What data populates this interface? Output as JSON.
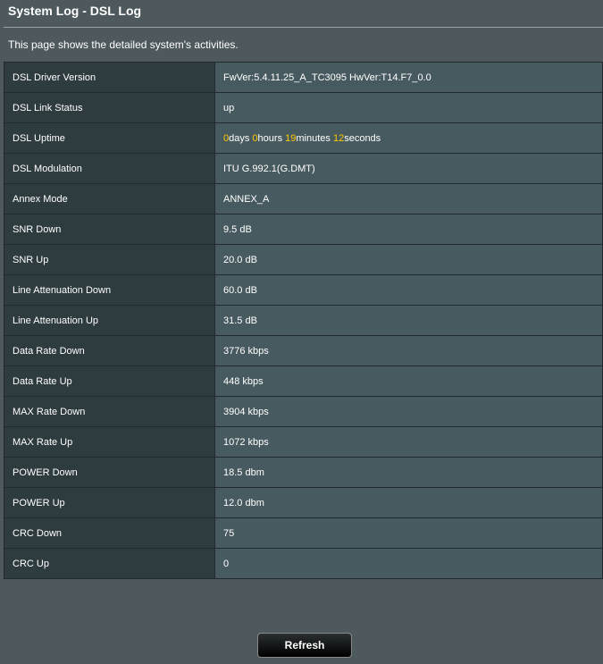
{
  "header": {
    "title": "System Log - DSL Log",
    "description": "This page shows the detailed system's activities."
  },
  "rows": [
    {
      "label": "DSL Driver Version",
      "value": "FwVer:5.4.11.25_A_TC3095 HwVer:T14.F7_0.0"
    },
    {
      "label": "DSL Link Status",
      "value": "up"
    },
    {
      "label": "DSL Uptime",
      "uptime": {
        "days": "0",
        "days_unit": "days ",
        "hours": "0",
        "hours_unit": "hours ",
        "minutes": "19",
        "minutes_unit": "minutes ",
        "seconds": "12",
        "seconds_unit": "seconds"
      }
    },
    {
      "label": "DSL Modulation",
      "value": "ITU G.992.1(G.DMT)"
    },
    {
      "label": "Annex Mode",
      "value": "ANNEX_A"
    },
    {
      "label": "SNR Down",
      "value": "9.5 dB"
    },
    {
      "label": "SNR Up",
      "value": "20.0 dB"
    },
    {
      "label": "Line Attenuation Down",
      "value": "60.0 dB"
    },
    {
      "label": "Line Attenuation Up",
      "value": "31.5 dB"
    },
    {
      "label": "Data Rate Down",
      "value": "3776 kbps"
    },
    {
      "label": "Data Rate Up",
      "value": "448 kbps"
    },
    {
      "label": "MAX Rate Down",
      "value": "3904 kbps"
    },
    {
      "label": "MAX Rate Up",
      "value": "1072 kbps"
    },
    {
      "label": "POWER Down",
      "value": "18.5 dbm"
    },
    {
      "label": "POWER Up",
      "value": "12.0 dbm"
    },
    {
      "label": "CRC Down",
      "value": "75"
    },
    {
      "label": "CRC Up",
      "value": "0"
    }
  ],
  "actions": {
    "refresh_label": "Refresh"
  },
  "colors": {
    "background": "#4d595d",
    "label_cell": "#2e3b3f",
    "value_cell": "#475a5f",
    "highlight": "#ffcc00"
  }
}
